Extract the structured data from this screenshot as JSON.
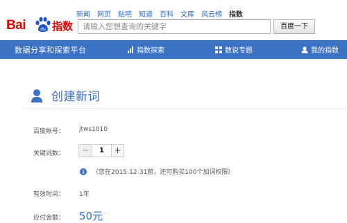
{
  "header": {
    "logo_text_latin": "Bai",
    "logo_text_cn": "指数",
    "top_nav": [
      "新闻",
      "网页",
      "贴吧",
      "知道",
      "百科",
      "文库",
      "风云榜",
      "指数"
    ],
    "active_nav": "指数",
    "search_placeholder": "请输入您想查询的关键字",
    "search_button": "百度一下"
  },
  "navbar": {
    "brand": "数据分享和探索平台",
    "items": [
      "指数探索",
      "数说专题",
      "我的指数"
    ],
    "background": "#3b72c4"
  },
  "form": {
    "title": "创建新词",
    "account_label": "百度帐号：",
    "account_value": "jtws1010",
    "keyword_count_label": "关键词数：",
    "stepper_minus": "−",
    "stepper_value": "1",
    "stepper_plus": "+",
    "notice": "（您在2015-12-31前，还可购买100个加词权限）",
    "validity_label": "有效时间：",
    "validity_value": "1年",
    "amount_label": "应付金额：",
    "amount_value": "50元"
  },
  "colors": {
    "accent": "#3b72c4",
    "brand_red": "#e10602",
    "link": "#2f6ec4"
  }
}
